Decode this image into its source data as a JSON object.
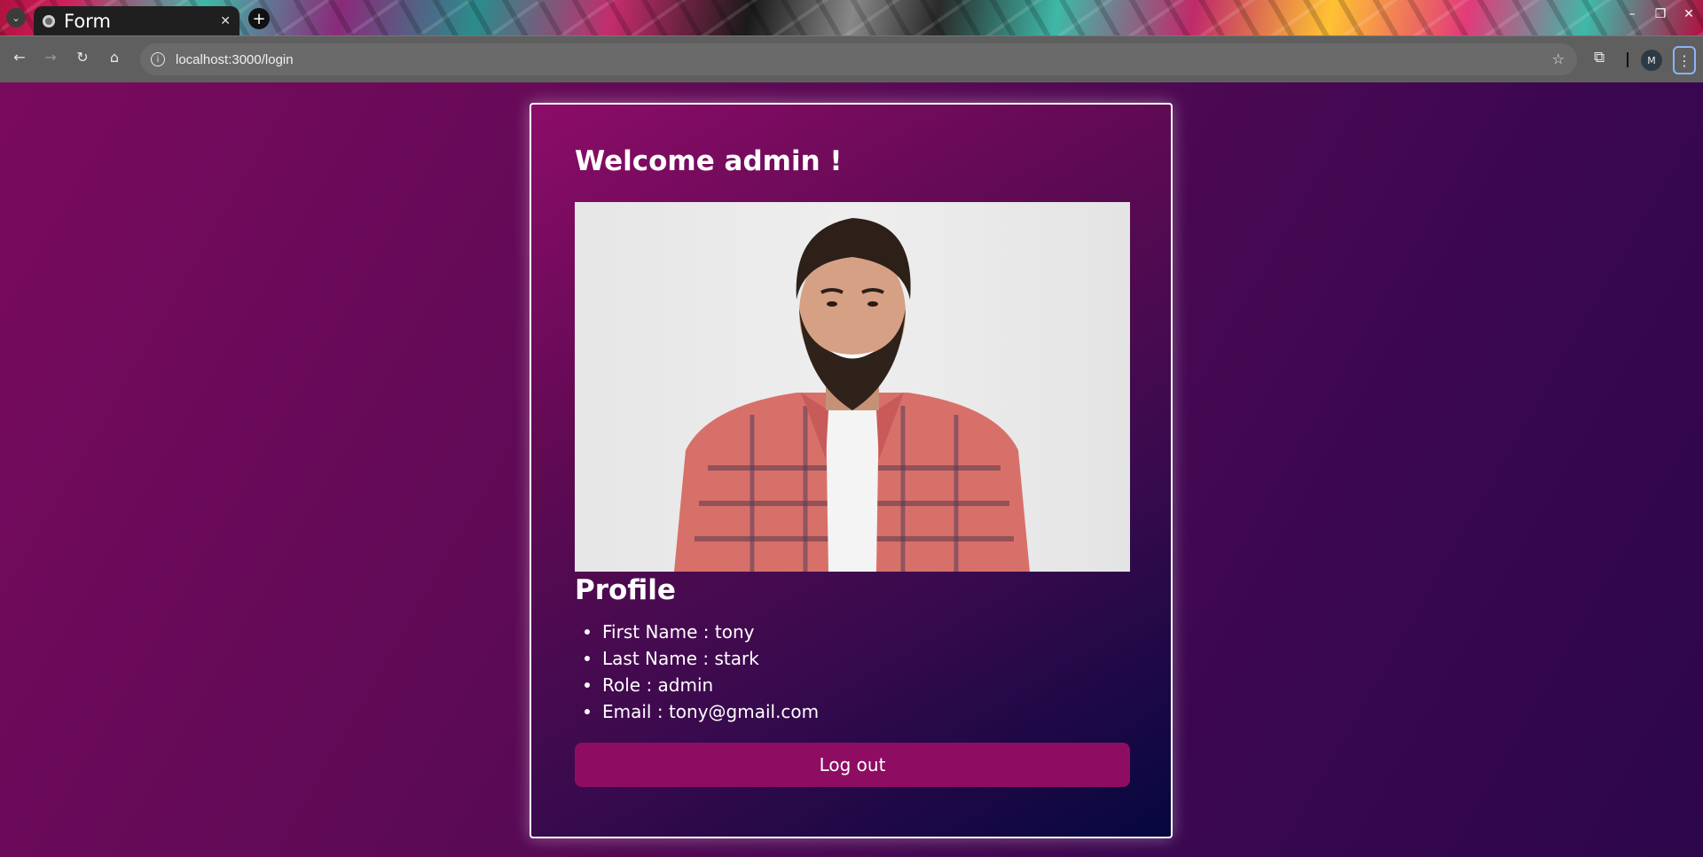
{
  "browser": {
    "tab": {
      "title": "Form",
      "close_icon": "close-icon",
      "favicon": "globe-icon"
    },
    "new_tab_icon": "plus-icon",
    "url": "localhost:3000/login",
    "window_controls": {
      "minimize": "–",
      "restore": "❐",
      "close": "✕"
    },
    "avatar_letter": "M"
  },
  "page": {
    "welcome_text": "Welcome admin !",
    "photo": "profile-photo",
    "profile_title": "Profile",
    "profile_items": [
      "First Name : tony",
      "Last Name : stark",
      "Role : admin",
      "Email : tony@gmail.com"
    ],
    "logout_label": "Log out"
  },
  "colors": {
    "accent_button": "#8e0d63",
    "card_border": "#ffffff",
    "page_gradient_start": "#7a0a5e",
    "page_gradient_end": "#2c064a"
  }
}
